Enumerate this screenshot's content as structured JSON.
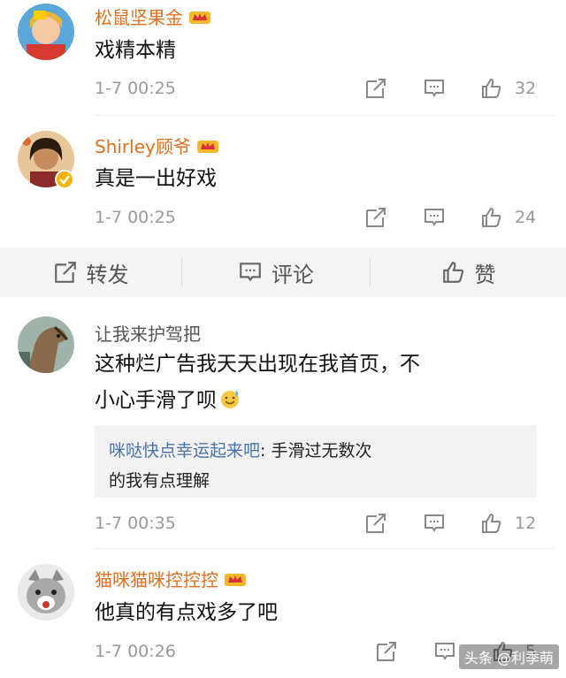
{
  "comments": [
    {
      "username": "松鼠坚果金",
      "text_lines": [
        "戏精本精"
      ],
      "time": "1-7 00:25",
      "likes": "32",
      "has_crown": true,
      "verified": false
    },
    {
      "username": "Shirley顾爷",
      "text_lines": [
        "真是一出好戏"
      ],
      "time": "1-7 00:25",
      "likes": "24",
      "has_crown": true,
      "verified": true
    },
    {
      "username": "让我来护驾把",
      "text_lines": [
        "这种烂广告我天天出现在我首页，不",
        "小心手滑了呗"
      ],
      "emoji_icon": "sweat-smile-emoji-icon",
      "reply": {
        "name": "咪哒快点幸运起来吧",
        "text_line1": ": 手滑过无数次",
        "text_line2": "的我有点理解"
      },
      "time": "1-7 00:35",
      "likes": "12",
      "has_crown": false,
      "verified": false
    },
    {
      "username": "猫咪猫咪控控控",
      "text_lines": [
        "他真的有点戏多了吧"
      ],
      "time": "1-7 00:26",
      "likes": "5",
      "has_crown": true,
      "verified": false
    }
  ],
  "action_bar": {
    "forward_label": "转发",
    "comment_label": "评论",
    "like_label": "赞"
  },
  "watermark": "头条 @利季萌",
  "colors": {
    "username_vip": "#e2701f",
    "reply_name": "#4a74a8",
    "meta_gray": "#999999",
    "action_bar_bg": "#f4f4f4"
  }
}
